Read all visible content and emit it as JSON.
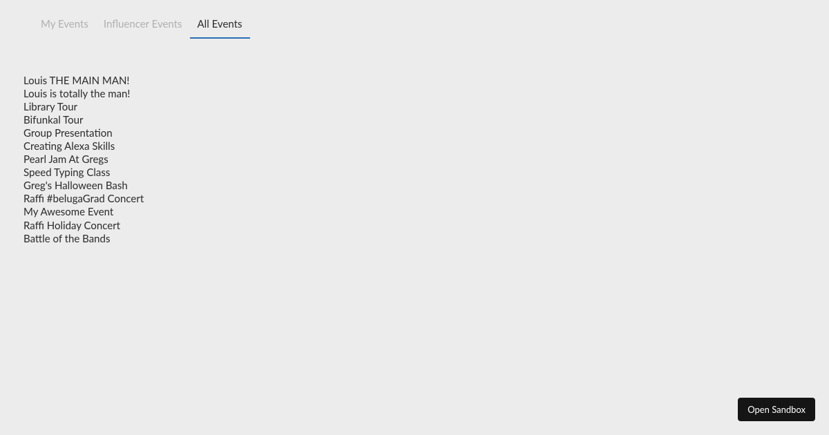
{
  "tabs": {
    "items": [
      {
        "label": "My Events",
        "active": false
      },
      {
        "label": "Influencer Events",
        "active": false
      },
      {
        "label": "All Events",
        "active": true
      }
    ]
  },
  "events": [
    "Louis THE MAIN MAN!",
    "Louis is totally the man!",
    "Library Tour",
    "Bifunkal Tour",
    "Group Presentation",
    "Creating Alexa Skills",
    "Pearl Jam At Gregs",
    "Speed Typing Class",
    "Greg's Halloween Bash",
    "Raffi #belugaGrad Concert",
    "My Awesome Event",
    "Raffi Holiday Concert",
    "Battle of the Bands"
  ],
  "footer": {
    "sandbox_button": "Open Sandbox"
  }
}
